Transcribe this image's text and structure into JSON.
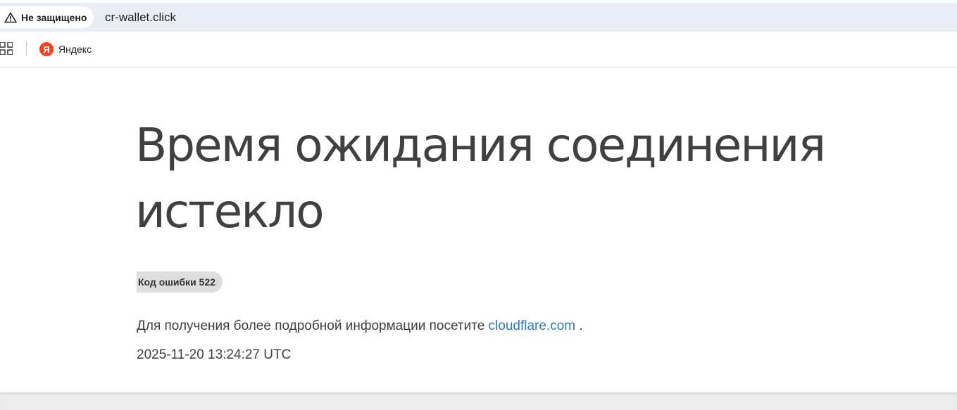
{
  "browser": {
    "security_label": "Не защищено",
    "url": "cr-wallet.click",
    "bookmarks": [
      {
        "label": "Яндекс",
        "icon": "yandex-logo-icon",
        "icon_letter": "Я"
      }
    ]
  },
  "page": {
    "title": "Время ожидания соединения истекло",
    "error_code": "Код ошибки 522",
    "info_prefix": "Для получения более подробной информации посетите",
    "info_link": "cloudflare.com",
    "info_suffix": ".",
    "timestamp": "2025-11-20 13:24:27 UTC"
  },
  "colors": {
    "link": "#2f7bbf",
    "text": "#404040",
    "yandex": "#fc3f1d",
    "address_bar": "#e9eef6"
  }
}
